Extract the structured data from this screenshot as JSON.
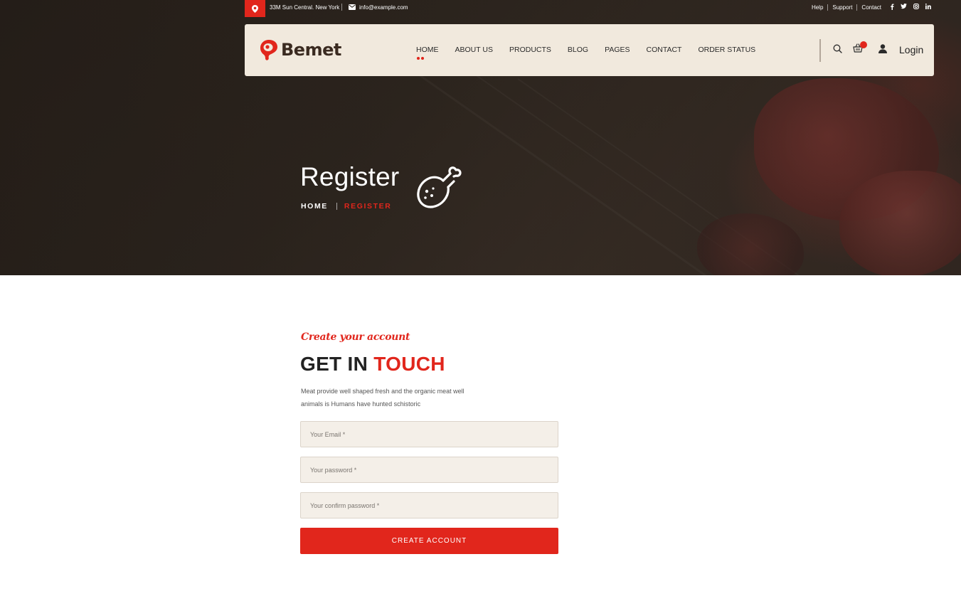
{
  "topbar": {
    "address": "33M Sun Central. New York",
    "email": "info@example.com",
    "links": [
      "Help",
      "Support",
      "Contact"
    ],
    "social": [
      "f",
      "t",
      "ig",
      "in"
    ]
  },
  "nav": {
    "logo": "Bemet",
    "menu": [
      "HOME",
      "ABOUT US",
      "PRODUCTS",
      "BLOG",
      "PAGES",
      "CONTACT",
      "ORDER STATUS"
    ],
    "active": "HOME",
    "login": "Login"
  },
  "hero": {
    "title": "Register",
    "breadcrumb_home": "HOME",
    "breadcrumb_current": "REGISTER"
  },
  "form": {
    "kicker": "Create your account",
    "heading_part1": "GET IN",
    "heading_part2": "TOUCH",
    "description": "Meat provide well shaped fresh and the organic meat well animals is Humans have hunted schistoric",
    "email_placeholder": "Your Email *",
    "password_placeholder": "Your password *",
    "confirm_placeholder": "Your confirm password *",
    "submit": "CREATE ACCOUNT"
  },
  "colors": {
    "accent": "#e1261c",
    "nav_bg": "#f1e9dd",
    "field_bg": "#f4efe8"
  }
}
